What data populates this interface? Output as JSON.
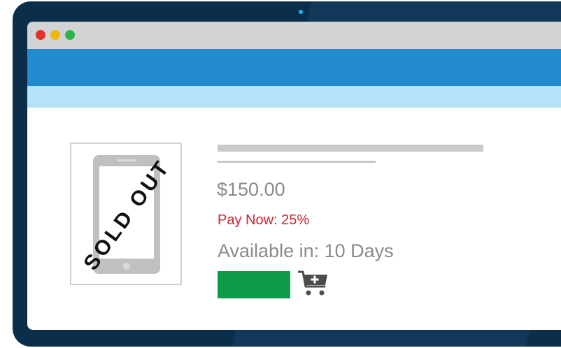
{
  "window": {
    "controls": [
      "close",
      "minimize",
      "maximize"
    ]
  },
  "product": {
    "image_icon": "smartphone-icon",
    "stamp": "SOLD OUT",
    "price": "$150.00",
    "pay_now": "Pay Now: 25%",
    "availability": "Available in: 10 Days",
    "buy_button_label": "",
    "cart_icon": "add-to-cart-icon"
  },
  "colors": {
    "device_frame": "#0b2e4b",
    "header": "#238ad0",
    "subheader": "#b5e2f7",
    "titlebar": "#d2d3d4",
    "pay_now_text": "#cf2230",
    "buy_button": "#0e9c4c",
    "close_dot": "#e0312d",
    "minimize_dot": "#f2b705",
    "maximize_dot": "#2db54a"
  }
}
